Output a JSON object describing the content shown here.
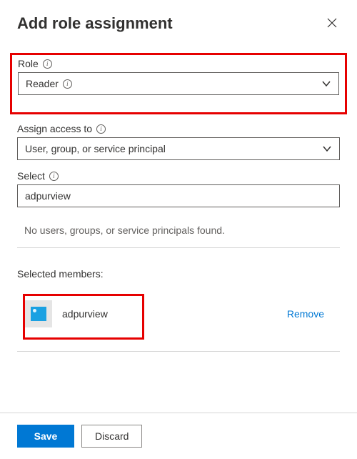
{
  "header": {
    "title": "Add role assignment"
  },
  "role": {
    "label": "Role",
    "value": "Reader"
  },
  "assignAccess": {
    "label": "Assign access to",
    "value": "User, group, or service principal"
  },
  "select": {
    "label": "Select",
    "value": "adpurview"
  },
  "results": {
    "empty": "No users, groups, or service principals found."
  },
  "selected": {
    "label": "Selected members:",
    "members": [
      {
        "name": "adpurview"
      }
    ],
    "removeLabel": "Remove"
  },
  "footer": {
    "save": "Save",
    "discard": "Discard"
  }
}
